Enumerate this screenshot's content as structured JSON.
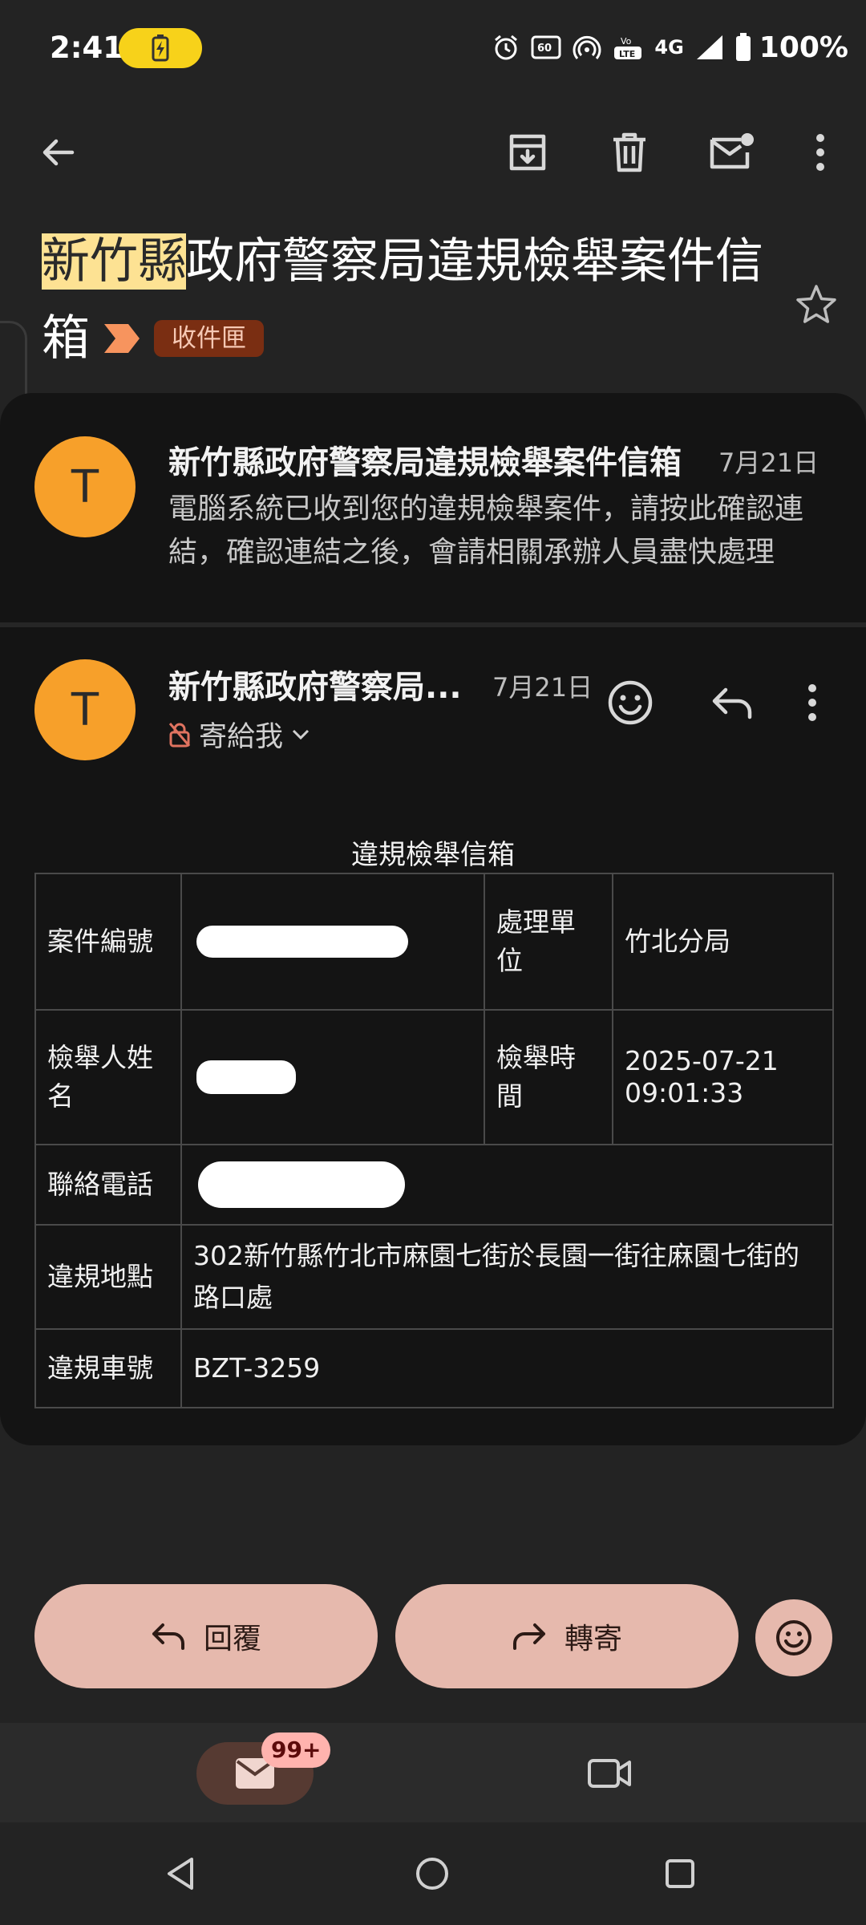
{
  "status_bar": {
    "time": "2:41",
    "network": "4G",
    "battery": "100%"
  },
  "toolbar": {
    "icons": [
      "back-arrow-icon",
      "archive-icon",
      "delete-icon",
      "mark-unread-icon",
      "more-vert-icon"
    ]
  },
  "subject": {
    "highlight": "新竹縣",
    "rest_line1": "政府警察局違規檢舉案件信",
    "line2": "箱",
    "label": "收件匣"
  },
  "thread": {
    "collapsed": {
      "avatar_letter": "T",
      "sender": "新竹縣政府警察局違規檢舉案件信箱",
      "date": "7月21日",
      "snippet": "電腦系統已收到您的違規檢舉案件，請按此確認連結，確認連結之後，會請相關承辦人員盡快處理"
    },
    "expanded": {
      "avatar_letter": "T",
      "sender": "新竹縣政府警察局...",
      "date": "7月21日",
      "to": "寄給我"
    }
  },
  "report": {
    "title": "違規檢舉信箱",
    "case_no_label": "案件編號",
    "unit_label": "處理單位",
    "unit_value": "竹北分局",
    "reporter_label": "檢舉人姓名",
    "time_label": "檢舉時間",
    "time_value": "2025-07-21 09:01:33",
    "phone_label": "聯絡電話",
    "location_label": "違規地點",
    "location_value": "302新竹縣竹北市麻園七街於長園一街往麻園七街的路口處",
    "plate_label": "違規車號",
    "plate_value": "BZT-3259"
  },
  "actions": {
    "reply": "回覆",
    "forward": "轉寄"
  },
  "bottom_nav": {
    "badge": "99+"
  },
  "colors": {
    "background": "#232323",
    "panel": "#141414",
    "avatar": "#f7a02a",
    "action_button": "#e6b9ad",
    "highlight": "#fde293",
    "label_chip": "#7a2e12"
  }
}
